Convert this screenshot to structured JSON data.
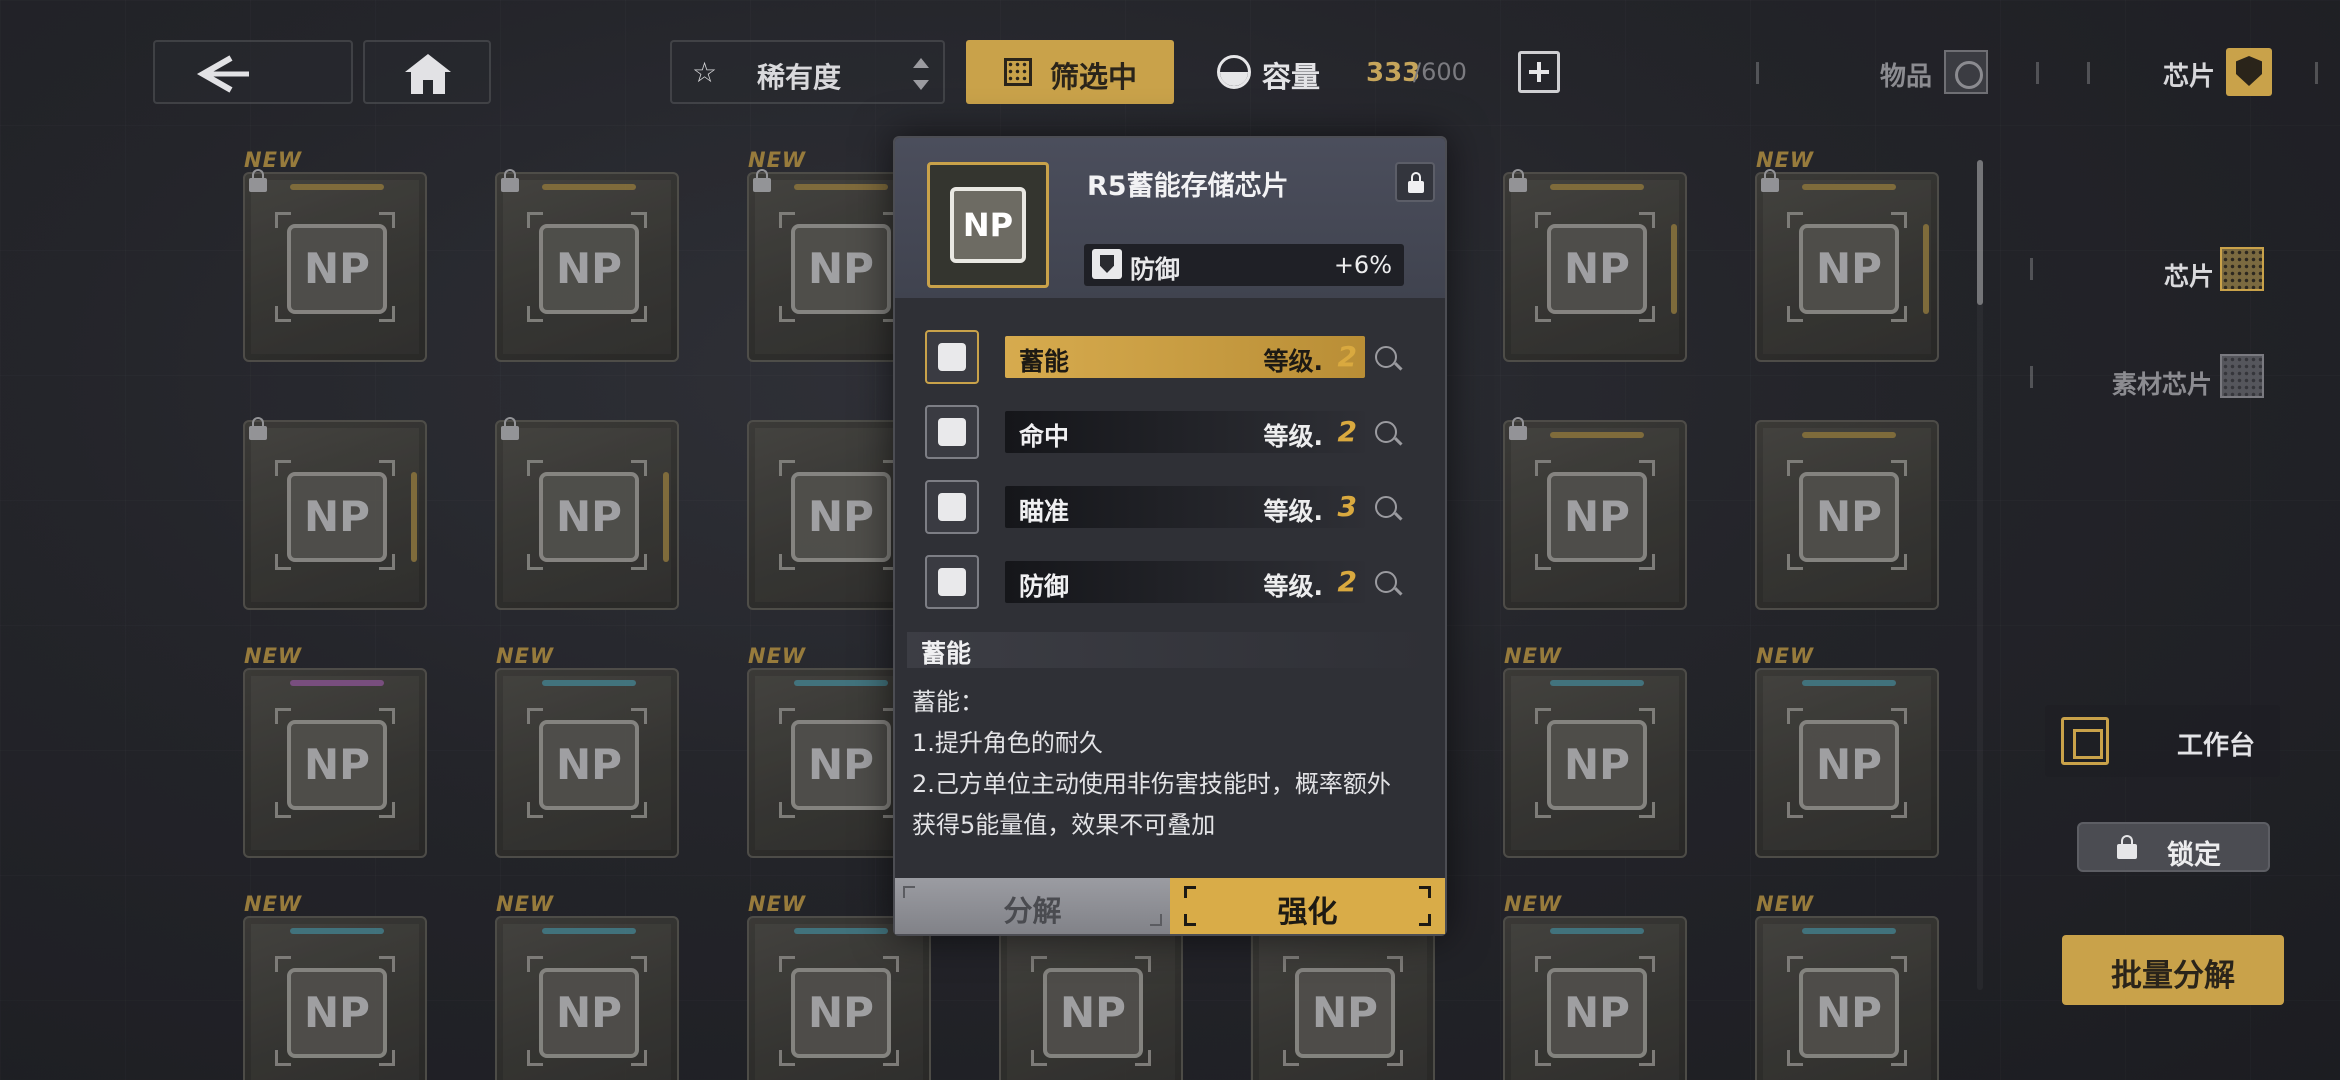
{
  "topbar": {
    "sort_label": "稀有度",
    "filter_label": "筛选中",
    "capacity_label": "容量",
    "capacity_value": "333",
    "capacity_max": "/600",
    "tab_items_label": "物品",
    "tab_chip_label": "芯片"
  },
  "grid": {
    "new_tag": "NEW",
    "chip_text": "NP"
  },
  "side": {
    "chip_label": "芯片",
    "material_label": "素材芯片",
    "workbench_label": "工作台",
    "lock_label": "锁定",
    "bulk_label": "批量分解"
  },
  "popup": {
    "thumb_text": "NP",
    "title": "R5蓄能存储芯片",
    "main_stat": {
      "name": "防御",
      "value": "+6%"
    },
    "skills": [
      {
        "name": "蓄能",
        "level_label": "等级.",
        "level": "2",
        "active": true
      },
      {
        "name": "命中",
        "level_label": "等级.",
        "level": "2",
        "active": false
      },
      {
        "name": "瞄准",
        "level_label": "等级.",
        "level": "3",
        "active": false
      },
      {
        "name": "防御",
        "level_label": "等级.",
        "level": "2",
        "active": false
      }
    ],
    "desc_title": "蓄能",
    "desc_lines": [
      "蓄能：",
      "1.提升角色的耐久",
      "2.己方单位主动使用非伤害技能时，概率额外",
      "获得5能量值，效果不可叠加"
    ],
    "decompose_label": "分解",
    "enhance_label": "强化"
  },
  "colors": {
    "accent_gold": "#c9a24a",
    "rarity_gold": "#b99a4c",
    "rarity_purple": "#b06cb6",
    "rarity_blue": "#5aa6b4"
  }
}
